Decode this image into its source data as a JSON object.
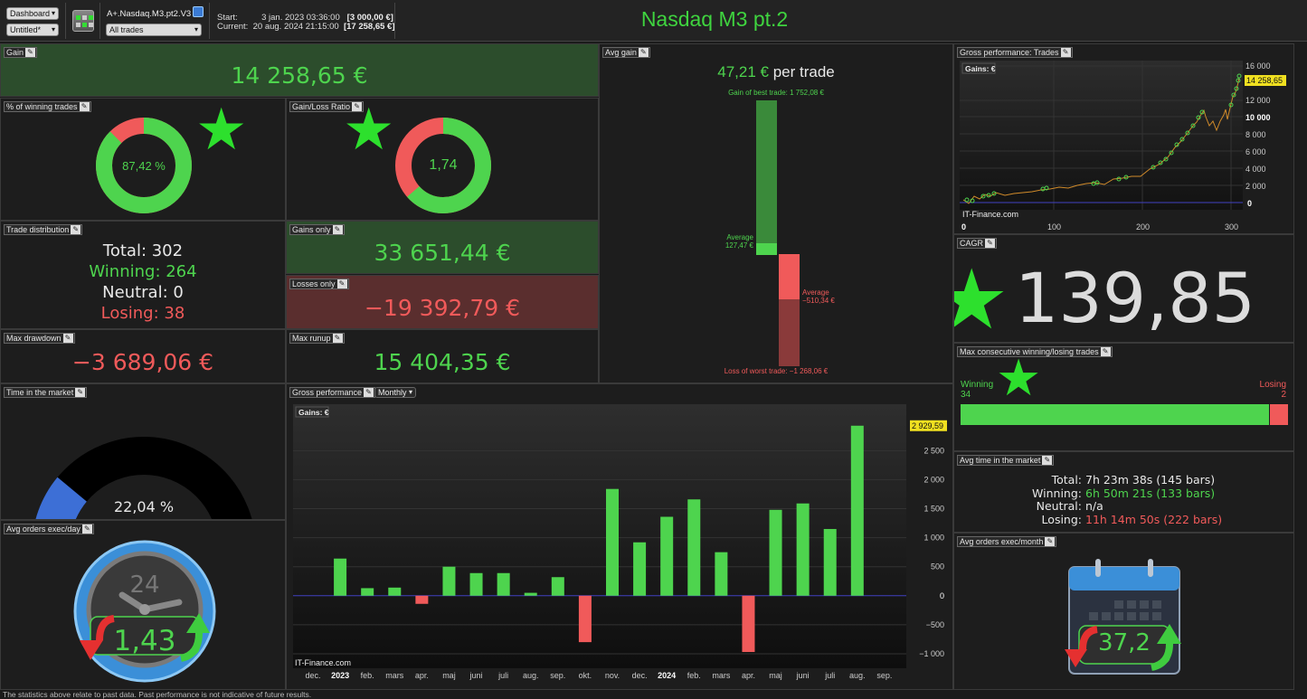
{
  "toolbar": {
    "view_select": "Dashboard",
    "layout_select": "Untitled*",
    "strategy_name": "A+.Nasdaq.M3.pt2.V3",
    "trades_filter": "All trades",
    "start_label": "Start:",
    "start_date": "3 jan. 2023 03:36:00",
    "start_value": "[3 000,00 €]",
    "current_label": "Current:",
    "current_date": "20 aug. 2024 21:15:00",
    "current_value": "[17 258,65 €]",
    "title": "Nasdaq M3 pt.2"
  },
  "gain": {
    "title": "Gain",
    "value": "14 258,65 €"
  },
  "winning_pct": {
    "title": "% of winning trades",
    "value": "87,42 %",
    "fraction": 0.8742
  },
  "gain_loss_ratio": {
    "title": "Gain/Loss Ratio",
    "value": "1,74",
    "fraction": 0.635
  },
  "trade_distribution": {
    "title": "Trade distribution",
    "total": "Total: 302",
    "winning": "Winning: 264",
    "neutral": "Neutral: 0",
    "losing": "Losing: 38"
  },
  "gains_only": {
    "title": "Gains only",
    "value": "33 651,44 €"
  },
  "losses_only": {
    "title": "Losses only",
    "value": "−19 392,79 €"
  },
  "max_drawdown": {
    "title": "Max drawdown",
    "value": "−3 689,06 €"
  },
  "max_runup": {
    "title": "Max runup",
    "value": "15 404,35 €"
  },
  "avg_gain": {
    "title": "Avg gain",
    "value": "47,21 €",
    "suffix": "per trade",
    "best_label": "Gain of best trade: 1 752,08 €",
    "avg_win_label": "Average",
    "avg_win_value": "127,47 €",
    "avg_loss_label": "Average",
    "avg_loss_value": "−510,34 €",
    "worst_label": "Loss of worst trade: −1 268,06 €"
  },
  "gross_trades": {
    "title": "Gross performance: Trades",
    "legend": "Gains: €",
    "last_value": "14 258,65",
    "watermark": "IT-Finance.com",
    "y_ticks": [
      "16 000",
      "12 000",
      "10 000",
      "8 000",
      "6 000",
      "4 000",
      "2 000",
      "0"
    ],
    "x_ticks": [
      "0",
      "100",
      "200",
      "300"
    ]
  },
  "cagr": {
    "title": "CAGR",
    "value": "139,85 %"
  },
  "consecutive": {
    "title": "Max consecutive winning/losing trades",
    "winning_label": "Winning",
    "winning_value": "34",
    "losing_label": "Losing",
    "losing_value": "2",
    "win_fraction": 0.944
  },
  "time_market": {
    "title": "Time in the market",
    "value": "22,04 %",
    "fraction": 0.2204
  },
  "avg_time": {
    "title": "Avg time in the market",
    "rows": [
      {
        "label": "Total:",
        "value": "7h 23m 38s (145 bars)"
      },
      {
        "label": "Winning:",
        "value": "6h 50m 21s (133 bars)"
      },
      {
        "label": "Neutral:",
        "value": "n/a"
      },
      {
        "label": "Losing:",
        "value": "11h 14m 50s (222 bars)"
      }
    ]
  },
  "orders_day": {
    "title": "Avg orders exec/day",
    "value": "1,43",
    "clock_label": "24"
  },
  "orders_month": {
    "title": "Avg orders exec/month",
    "value": "37,2"
  },
  "gross_monthly": {
    "title": "Gross performance",
    "period": "Monthly",
    "legend": "Gains: €",
    "watermark": "IT-Finance.com"
  },
  "chart_data": {
    "type": "bar",
    "title": "Gross performance",
    "ylabel": "Gains: €",
    "categories": [
      "dec.",
      "2023",
      "feb.",
      "mars",
      "apr.",
      "maj",
      "juni",
      "juli",
      "aug.",
      "sep.",
      "okt.",
      "nov.",
      "dec.",
      "2024",
      "feb.",
      "mars",
      "apr.",
      "maj",
      "juni",
      "juli",
      "aug.",
      "sep."
    ],
    "values": [
      0,
      640,
      130,
      140,
      -140,
      500,
      390,
      390,
      50,
      320,
      -800,
      1840,
      920,
      1360,
      1660,
      750,
      -970,
      1480,
      1590,
      1150,
      2929.59,
      0
    ],
    "last_value_label": "2 929,59",
    "ylim": [
      -1250,
      3300
    ],
    "y_ticks": [
      2500,
      2000,
      1500,
      1000,
      500,
      0,
      -500,
      -1000
    ],
    "y_tick_labels": [
      "2 500",
      "2 000",
      "1 500",
      "1 000",
      "500",
      "0",
      "−500",
      "−1 000"
    ]
  },
  "footer": {
    "text": "The statistics above relate to past data. Past performance is not indicative of future results."
  },
  "colors": {
    "green": "#4ed44e",
    "red": "#f05a5a",
    "title_green": "#3fd43f",
    "blue": "#3d6fd6"
  }
}
